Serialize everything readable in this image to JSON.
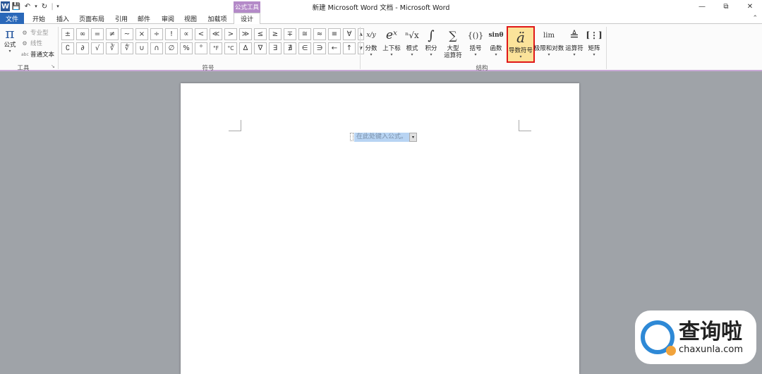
{
  "window": {
    "title": "新建 Microsoft Word 文档 - Microsoft Word",
    "contextual_tab": "公式工具",
    "qat": [
      "W",
      "💾",
      "↶",
      "▾",
      "↻",
      "|",
      "▾"
    ],
    "controls": {
      "minimize": "—",
      "restore": "⧉",
      "close": "✕"
    },
    "ribbon_toggle": "⌃"
  },
  "tabs": [
    "文件",
    "开始",
    "插入",
    "页面布局",
    "引用",
    "邮件",
    "审阅",
    "视图",
    "加载项",
    "设计"
  ],
  "tools_group": {
    "label": "工具",
    "formula_label": "公式",
    "items": [
      "专业型",
      "线性",
      "普通文本"
    ],
    "item_icons": [
      "⚙",
      "⚙",
      "abc"
    ]
  },
  "symbols_group": {
    "label": "符号",
    "row1": [
      "±",
      "∞",
      "=",
      "≠",
      "~",
      "×",
      "÷",
      "!",
      "∝",
      "<",
      "≪",
      ">",
      "≫",
      "≤",
      "≥",
      "∓",
      "≅",
      "≈",
      "≡",
      "∀"
    ],
    "row2": [
      "∁",
      "∂",
      "√",
      "∛",
      "∜",
      "∪",
      "∩",
      "∅",
      "%",
      "°",
      "°F",
      "°C",
      "∆",
      "∇",
      "∃",
      "∄",
      "∈",
      "∋",
      "←",
      "↑"
    ],
    "scroll": [
      "▲",
      "▼",
      "▾"
    ]
  },
  "structures_group": {
    "label": "结构",
    "items": [
      {
        "icon": "x/y",
        "label": "分数",
        "label2": ""
      },
      {
        "icon": "eˣ",
        "label": "上下标",
        "label2": ""
      },
      {
        "icon": "ⁿ√x",
        "label": "根式",
        "label2": ""
      },
      {
        "icon": "∫",
        "label": "积分",
        "label2": ""
      },
      {
        "icon": "∑",
        "label": "大型",
        "label2": "运算符"
      },
      {
        "icon": "{()}",
        "label": "括号",
        "label2": ""
      },
      {
        "icon": "sinθ",
        "label": "函数",
        "label2": ""
      },
      {
        "icon": "ä",
        "label": "导数符号",
        "label2": ""
      },
      {
        "icon": "lim",
        "label": "极限和对数",
        "label2": ""
      },
      {
        "icon": "≜",
        "label": "运算符",
        "label2": ""
      },
      {
        "icon": "[⋮]",
        "label": "矩阵",
        "label2": ""
      }
    ],
    "dropdown": "▾"
  },
  "document": {
    "equation_placeholder": "在此处键入公式。"
  },
  "watermark": {
    "cn": "查询啦",
    "en": "chaxunla.com"
  }
}
